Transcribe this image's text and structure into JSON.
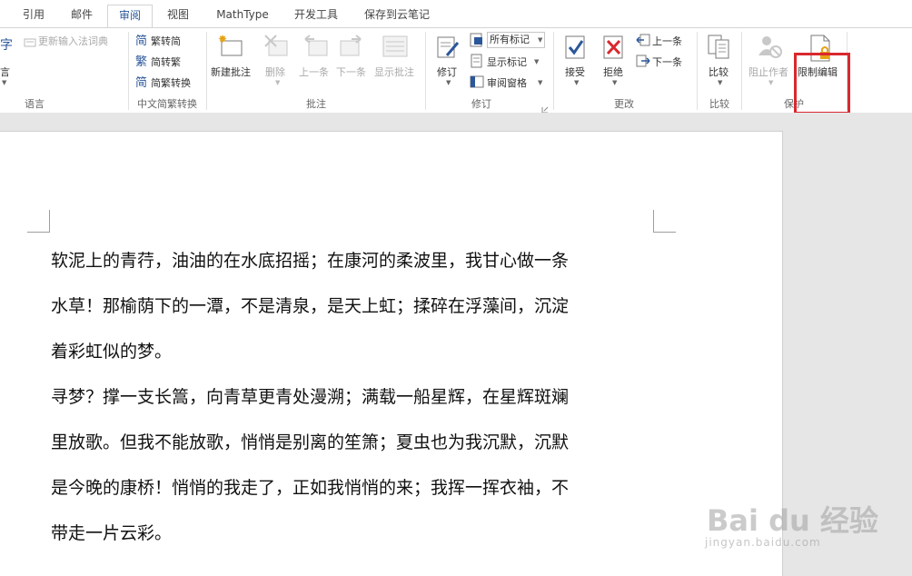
{
  "tabs": [
    "引用",
    "邮件",
    "审阅",
    "视图",
    "MathType",
    "开发工具",
    "保存到云笔记"
  ],
  "ribbon": {
    "language": {
      "btn": "言",
      "update_ime": "更新输入法词典",
      "group": "语言"
    },
    "chinese": {
      "t2s": "繁转简",
      "s2t": "简转繁",
      "convert": "简繁转换",
      "group": "中文简繁转换"
    },
    "comments": {
      "new": "新建批注",
      "delete": "删除",
      "prev": "上一条",
      "next": "下一条",
      "show": "显示批注",
      "group": "批注"
    },
    "tracking": {
      "revise": "修订",
      "markup_value": "所有标记",
      "show_markup": "显示标记",
      "review_pane": "审阅窗格",
      "group": "修订"
    },
    "changes": {
      "accept": "接受",
      "reject": "拒绝",
      "prev": "上一条",
      "next": "下一条",
      "group": "更改"
    },
    "compare": {
      "compare": "比较",
      "group": "比较"
    },
    "protect": {
      "block_authors": "阻止作者",
      "restrict_editing": "限制编辑",
      "group": "保护"
    }
  },
  "document": {
    "lines": [
      "软泥上的青荇，油油的在水底招摇；在康河的柔波里，我甘心做一条",
      "水草！那榆荫下的一潭，不是清泉，是天上虹；揉碎在浮藻间，沉淀",
      "着彩虹似的梦。",
      "寻梦？撑一支长篙，向青草更青处漫溯；满载一船星辉，在星辉斑斓",
      "里放歌。但我不能放歌，悄悄是别离的笙箫；夏虫也为我沉默，沉默",
      "是今晚的康桥！悄悄的我走了，正如我悄悄的来；我挥一挥衣袖，不",
      "带走一片云彩。"
    ]
  },
  "watermark": {
    "brand": "Bai du 经验",
    "url": "jingyan.baidu.com"
  },
  "colors": {
    "accent": "#2b579a",
    "highlight": "#d9282f"
  }
}
